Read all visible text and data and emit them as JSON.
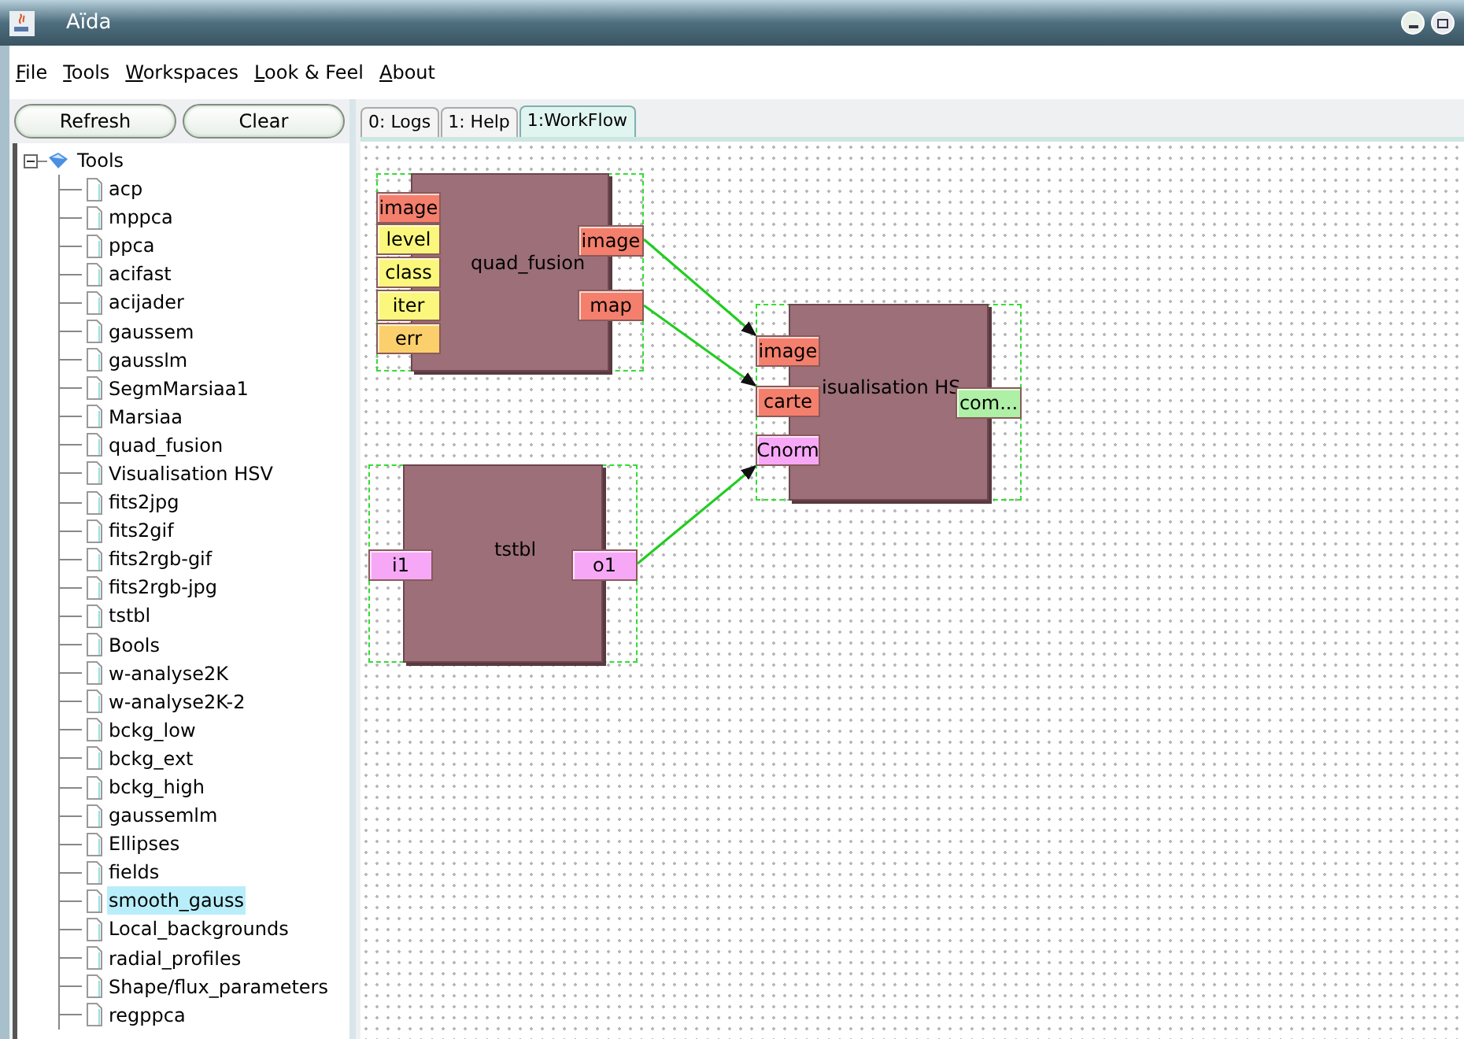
{
  "window": {
    "title": "Aïda"
  },
  "menu": [
    "File",
    "Tools",
    "Workspaces",
    "Look & Feel",
    "About"
  ],
  "buttons": [
    "Refresh",
    "Clear"
  ],
  "tree": {
    "label": "Tools",
    "expanded": true,
    "children": [
      {
        "label": "acp",
        "selected": false
      },
      {
        "label": "mppca",
        "selected": false
      },
      {
        "label": "ppca",
        "selected": false
      },
      {
        "label": "acifast",
        "selected": false
      },
      {
        "label": "acijader",
        "selected": false
      },
      {
        "label": "gaussem",
        "selected": false
      },
      {
        "label": "gausslm",
        "selected": false
      },
      {
        "label": "SegmMarsiaa1",
        "selected": false
      },
      {
        "label": "Marsiaa",
        "selected": false
      },
      {
        "label": "quad_fusion",
        "selected": false
      },
      {
        "label": "Visualisation HSV",
        "selected": false
      },
      {
        "label": "fits2jpg",
        "selected": false
      },
      {
        "label": "fits2gif",
        "selected": false
      },
      {
        "label": "fits2rgb-gif",
        "selected": false
      },
      {
        "label": "fits2rgb-jpg",
        "selected": false
      },
      {
        "label": "tstbl",
        "selected": false
      },
      {
        "label": "Bools",
        "selected": false
      },
      {
        "label": "w-analyse2K",
        "selected": false
      },
      {
        "label": "w-analyse2K-2",
        "selected": false
      },
      {
        "label": "bckg_low",
        "selected": false
      },
      {
        "label": "bckg_ext",
        "selected": false
      },
      {
        "label": "bckg_high",
        "selected": false
      },
      {
        "label": "gaussemlm",
        "selected": false
      },
      {
        "label": "Ellipses",
        "selected": false
      },
      {
        "label": "fields",
        "selected": false
      },
      {
        "label": "smooth_gauss",
        "selected": true
      },
      {
        "label": "Local_backgrounds",
        "selected": false
      },
      {
        "label": "radial_profiles",
        "selected": false
      },
      {
        "label": "Shape/flux_parameters",
        "selected": false
      },
      {
        "label": "regppca",
        "selected": false
      }
    ]
  },
  "tabs": [
    {
      "label": "0: Logs",
      "selected": false
    },
    {
      "label": "1: Help",
      "selected": false
    },
    {
      "label": "1:WorkFlow",
      "selected": true
    }
  ],
  "nodes": [
    {
      "title": "quad_fusion",
      "inputs": [
        {
          "name": "image",
          "color": "#f47f6c"
        },
        {
          "name": "level",
          "color": "#fbf77c"
        },
        {
          "name": "class",
          "color": "#fbf77c"
        },
        {
          "name": "iter",
          "color": "#fbf77c"
        },
        {
          "name": "err",
          "color": "#fbd06c"
        }
      ],
      "outputs": [
        {
          "name": "image",
          "color": "#f47f6c"
        },
        {
          "name": "map",
          "color": "#f47f6c"
        }
      ]
    },
    {
      "title": "isualisation HS",
      "inputs": [
        {
          "name": "image",
          "color": "#f47f6c"
        },
        {
          "name": "carte",
          "color": "#f47f6c"
        },
        {
          "name": "Cnorm",
          "color": "#f6a8f6"
        }
      ],
      "outputs": [
        {
          "name": "com...",
          "color": "#aef0a6"
        }
      ]
    },
    {
      "title": "tstbl",
      "inputs": [
        {
          "name": "i1",
          "color": "#f6a8f6"
        }
      ],
      "outputs": [
        {
          "name": "o1",
          "color": "#f6a8f6"
        }
      ]
    }
  ]
}
